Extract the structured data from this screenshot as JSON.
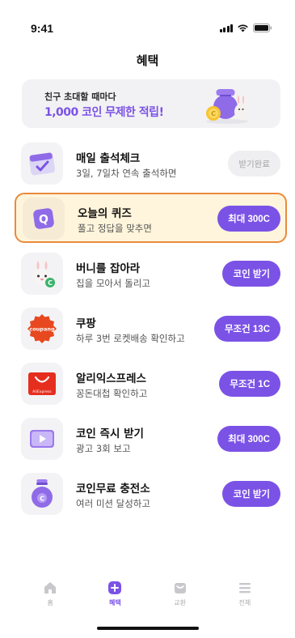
{
  "status_bar": {
    "time": "9:41"
  },
  "header": {
    "title": "혜택"
  },
  "promo": {
    "line1": "친구 초대할 때마다",
    "line2": "1,000 코인 무제한 적립!"
  },
  "benefits": [
    {
      "title": "매일 출석체크",
      "subtitle": "3일, 7일차 연속 출석하면",
      "button": "받기완료",
      "icon": "calendar-check-icon"
    },
    {
      "title": "오늘의 퀴즈",
      "subtitle": "풀고 정답을 맞추면",
      "button": "최대 300C",
      "icon": "quiz-q-icon"
    },
    {
      "title": "버니를 잡아라",
      "subtitle": "칩을 모아서 돌리고",
      "button": "코인 받기",
      "icon": "bunny-icon"
    },
    {
      "title": "쿠팡",
      "subtitle": "하루 3번 로켓배송 확인하고",
      "button": "무조건 13C",
      "icon": "coupang-logo-icon",
      "icon_text": "coupang"
    },
    {
      "title": "알리익스프레스",
      "subtitle": "꽁돈대첩 확인하고",
      "button": "무조건 1C",
      "icon": "aliexpress-logo-icon",
      "icon_text": "AliExpress"
    },
    {
      "title": "코인 즉시 받기",
      "subtitle": "광고 3회 보고",
      "button": "최대 300C",
      "icon": "play-video-icon"
    },
    {
      "title": "코인무료 충전소",
      "subtitle": "여러 미션 달성하고",
      "button": "코인 받기",
      "icon": "coin-bag-icon"
    }
  ],
  "tabs": [
    {
      "label": "홈",
      "icon": "home-icon",
      "active": false
    },
    {
      "label": "혜택",
      "icon": "plus-circle-icon",
      "active": true
    },
    {
      "label": "교환",
      "icon": "gift-box-icon",
      "active": false
    },
    {
      "label": "전체",
      "icon": "menu-icon",
      "active": false
    }
  ],
  "colors": {
    "accent": "#7b52e6",
    "highlight_bg": "#fff5dc",
    "highlight_border": "#ea8a3c"
  }
}
